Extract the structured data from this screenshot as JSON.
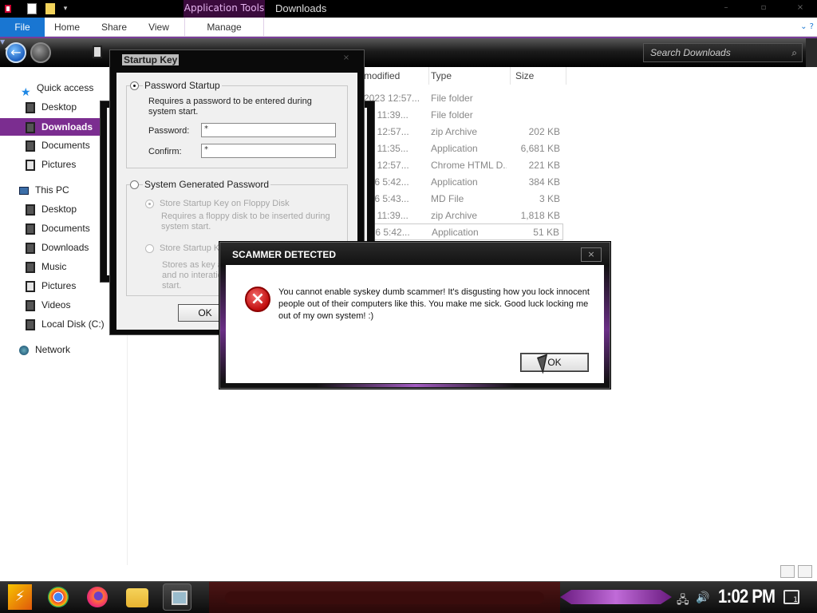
{
  "window": {
    "title": "Downloads",
    "contextual_tab": "Application Tools",
    "qa_dropdown": "▾"
  },
  "ribbon": {
    "tabs": [
      "File",
      "Home",
      "Share",
      "View",
      "Manage"
    ]
  },
  "address": {
    "search_placeholder": "Search Downloads"
  },
  "nav": {
    "items": [
      {
        "label": "Quick access"
      },
      {
        "label": "Desktop"
      },
      {
        "label": "Downloads"
      },
      {
        "label": "Documents"
      },
      {
        "label": "Pictures"
      },
      {
        "label": "This PC"
      },
      {
        "label": "Desktop"
      },
      {
        "label": "Documents"
      },
      {
        "label": "Downloads"
      },
      {
        "label": "Music"
      },
      {
        "label": "Pictures"
      },
      {
        "label": "Videos"
      },
      {
        "label": "Local Disk (C:)"
      },
      {
        "label": "Network"
      }
    ]
  },
  "files": {
    "columns": {
      "date": "modified",
      "type": "Type",
      "size": "Size"
    },
    "rows": [
      {
        "date": "2023 12:57...",
        "type": "File folder",
        "size": ""
      },
      {
        "date": "23 11:39...",
        "type": "File folder",
        "size": ""
      },
      {
        "date": "23 12:57...",
        "type": "zip Archive",
        "size": "202 KB"
      },
      {
        "date": "23 11:35...",
        "type": "Application",
        "size": "6,681 KB"
      },
      {
        "date": "23 12:57...",
        "type": "Chrome HTML D...",
        "size": "221 KB"
      },
      {
        "date": "016 5:42...",
        "type": "Application",
        "size": "384 KB"
      },
      {
        "date": "016 5:43...",
        "type": "MD File",
        "size": "3 KB"
      },
      {
        "date": "23 11:39...",
        "type": "zip Archive",
        "size": "1,818 KB"
      },
      {
        "date": "016 5:42...",
        "type": "Application",
        "size": "51 KB"
      }
    ]
  },
  "startup_key": {
    "title": "Startup Key",
    "password_startup": "Password Startup",
    "password_desc": "Requires a password to be entered during system start.",
    "password_label": "Password:",
    "password_value": "*",
    "confirm_label": "Confirm:",
    "confirm_value": "*",
    "system_generated": "System Generated Password",
    "floppy_option": "Store Startup Key on Floppy Disk",
    "floppy_desc": "Requires a floppy disk to be inserted during system start.",
    "local_option": "Store Startup Ke",
    "local_desc_1": "Stores a",
    "local_desc_2": "s key a",
    "local_desc_3": "and no interatio",
    "local_desc_4": "start.",
    "ok": "OK"
  },
  "scammer_dialog": {
    "title": "SCAMMER DETECTED",
    "close": "×",
    "message": "You cannot enable syskey dumb scammer! It's disgusting how you lock innocent people out of their computers like this. You make me sick. Good luck locking me out of my own system! :)",
    "ok": "OK",
    "icon": "error-icon"
  },
  "taskbar": {
    "clock": "1:02 PM",
    "notifications": "1"
  }
}
